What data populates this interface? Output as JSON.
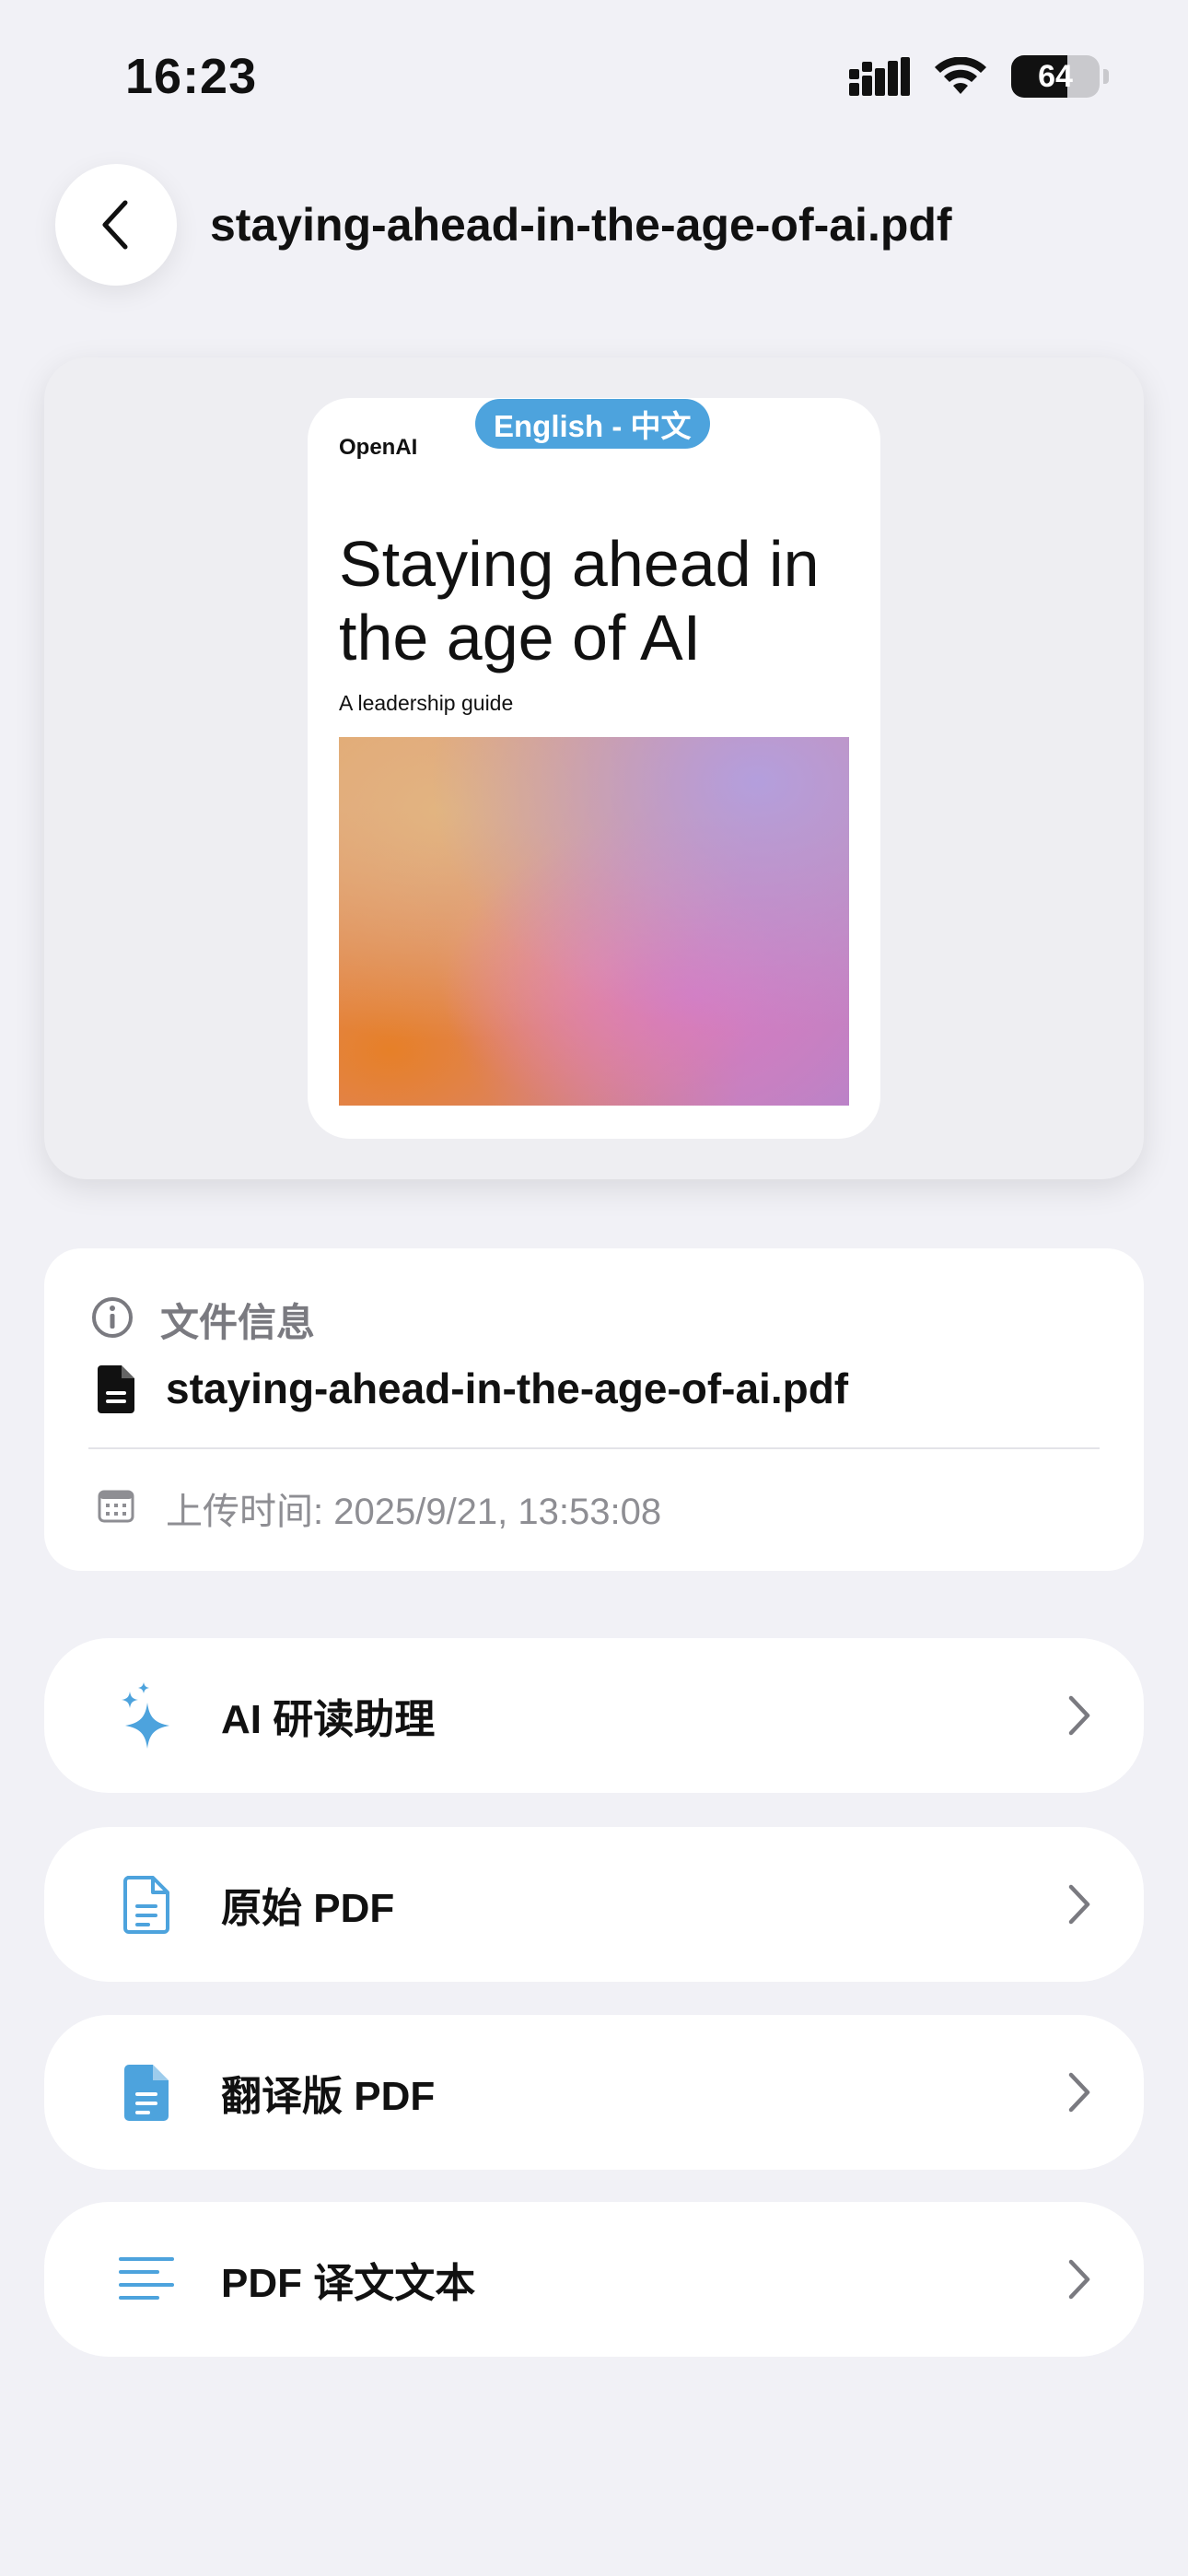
{
  "status_bar": {
    "time": "16:23",
    "battery": "64",
    "battery_level": 0.64
  },
  "header": {
    "back_icon": "chevron-left-icon",
    "title": "staying-ahead-in-the-age-of-ai.pdf"
  },
  "preview": {
    "language_badge": "English - 中文",
    "brand": "OpenAI",
    "doc_title": "Staying ahead in the age of AI",
    "doc_subtitle": "A leadership guide"
  },
  "file_info": {
    "heading": "文件信息",
    "file_name": "staying-ahead-in-the-age-of-ai.pdf",
    "upload_time": "上传时间: 2025/9/21, 13:53:08"
  },
  "menu": [
    {
      "label": "AI 研读助理",
      "icon": "sparkle-icon"
    },
    {
      "label": "原始 PDF",
      "icon": "document-outline-icon"
    },
    {
      "label": "翻译版 PDF",
      "icon": "document-filled-icon"
    },
    {
      "label": "PDF 译文文本",
      "icon": "text-lines-icon"
    }
  ],
  "colors": {
    "accent": "#4da3dd",
    "background": "#f1f1f6"
  }
}
